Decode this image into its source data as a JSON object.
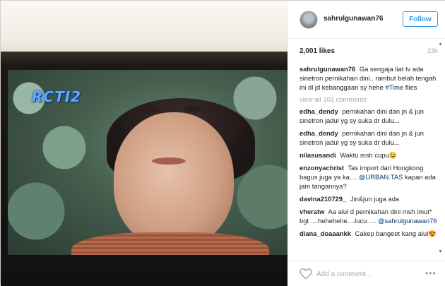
{
  "photo": {
    "channel_logo_text": "RCTI2"
  },
  "header": {
    "username": "sahrulgunawan76",
    "follow_label": "Follow"
  },
  "stats": {
    "likes": "2,001 likes",
    "time": "23h"
  },
  "caption": {
    "user": "sahrulgunawan76",
    "text": "Ga sengaja liat tv ada sinetron pernikahan dini.. rambut belah tengah ini dl jd kebanggaan sy hehe",
    "hashtag": "#Time",
    "text_after": "flies"
  },
  "view_all": "view all 102 comments",
  "comments": [
    {
      "user": "edha_dendy",
      "text": "pernikahan dini dan jn & jun sinetron jadul yg sy suka dr dulu..."
    },
    {
      "user": "edha_dendy",
      "text": "pernikahan dini dan jn & jun sinetron jadul yg sy suka dr dulu..."
    },
    {
      "user": "nilasusandi",
      "text": "Waktu msh cupu😉"
    },
    {
      "user": "enzonyachrist",
      "text": "Tas import dari Hongkong bagus juga ya ka....",
      "mention": "@URBAN.TAS",
      "text_after": "kapan ada jam tangannya?"
    },
    {
      "user": "davina210729_",
      "text": "Jin&jun juga ada"
    },
    {
      "user": "vheratw",
      "text": "Aa alul d pernikahan dini msh imut* bgt ....hehehehe....lucu ....",
      "mention": "@sahrulgunawan76",
      "text_after": ""
    },
    {
      "user": "diana_doaaankk",
      "text": "Cakep bangeet kang alul😍"
    }
  ],
  "footer": {
    "add_comment_placeholder": "Add a comment...",
    "more_label": "•••"
  },
  "colors": {
    "accent": "#3897f0",
    "mention": "#003569",
    "muted": "#a5a7aa"
  }
}
